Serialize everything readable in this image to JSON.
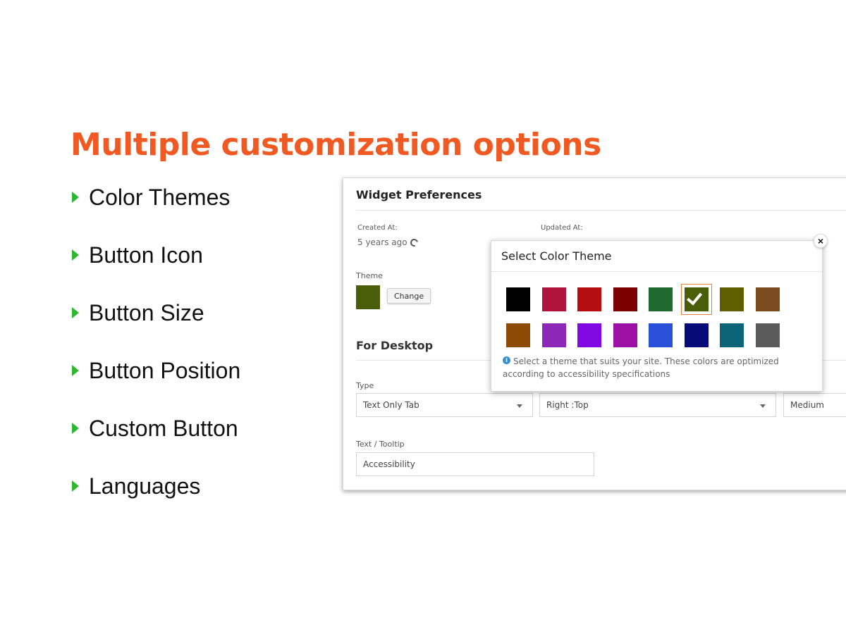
{
  "headline": "Multiple customization options",
  "features": [
    "Color Themes",
    "Button Icon",
    "Button Size",
    "Button Position",
    "Custom Button",
    "Languages"
  ],
  "panel": {
    "title": "Widget Preferences",
    "created_label": "Created At:",
    "created_value": "5 years ago",
    "updated_label": "Updated At:",
    "theme_label": "Theme",
    "theme_color": "#4a5e0a",
    "change_label": "Change",
    "desktop_title": "For Desktop",
    "type_label": "Type",
    "type_value": "Text Only Tab",
    "position_value": "Right :Top",
    "size_value": "Medium",
    "tooltip_label": "Text / Tooltip",
    "tooltip_value": "Accessibility"
  },
  "popup": {
    "title": "Select Color Theme",
    "close_glyph": "×",
    "info": "Select a theme that suits your site. These colors are optimized according to accessibility specifications",
    "colors": [
      "#000000",
      "#b0143c",
      "#b50e12",
      "#7d0000",
      "#1f6a2f",
      "#4a5e0a",
      "#615e00",
      "#7a4b1e",
      "#8d4a05",
      "#8d27b8",
      "#8008e0",
      "#9d10a6",
      "#2a50d8",
      "#060b79",
      "#0b6478",
      "#5b5b5b"
    ],
    "selected_index": 5
  },
  "colors": {
    "accent": "#f05a22",
    "bullet": "#2fb82f"
  }
}
